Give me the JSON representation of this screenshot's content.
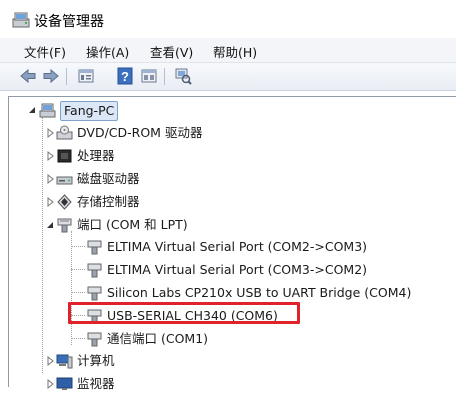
{
  "window": {
    "title": "设备管理器",
    "icon": "device-manager-icon"
  },
  "menu": [
    {
      "label": "文件(F)"
    },
    {
      "label": "操作(A)"
    },
    {
      "label": "查看(V)"
    },
    {
      "label": "帮助(H)"
    }
  ],
  "toolbar": {
    "buttons": [
      "back-arrow-icon",
      "forward-arrow-icon",
      "properties-icon",
      "help-icon",
      "view-icon",
      "scan-hardware-icon"
    ]
  },
  "tree": {
    "root": "Fang-PC",
    "nodes": [
      {
        "label": "DVD/CD-ROM 驱动器",
        "icon": "dvd-drive-icon"
      },
      {
        "label": "处理器",
        "icon": "processor-icon"
      },
      {
        "label": "磁盘驱动器",
        "icon": "disk-drive-icon"
      },
      {
        "label": "存储控制器",
        "icon": "storage-controller-icon"
      },
      {
        "label": "端口 (COM 和 LPT)",
        "icon": "port-icon",
        "expanded": true,
        "children": [
          {
            "label": "ELTIMA Virtual Serial Port (COM2->COM3)"
          },
          {
            "label": "ELTIMA Virtual Serial Port (COM3->COM2)"
          },
          {
            "label": "Silicon Labs CP210x USB to UART Bridge (COM4)"
          },
          {
            "label": "USB-SERIAL CH340 (COM6)",
            "highlighted": true
          },
          {
            "label": "通信端口 (COM1)"
          }
        ]
      },
      {
        "label": "计算机",
        "icon": "computer-icon"
      },
      {
        "label": "监视器",
        "icon": "monitor-icon"
      }
    ]
  },
  "colors": {
    "highlight": "#e0222a",
    "selection": "#dbe7f7"
  }
}
